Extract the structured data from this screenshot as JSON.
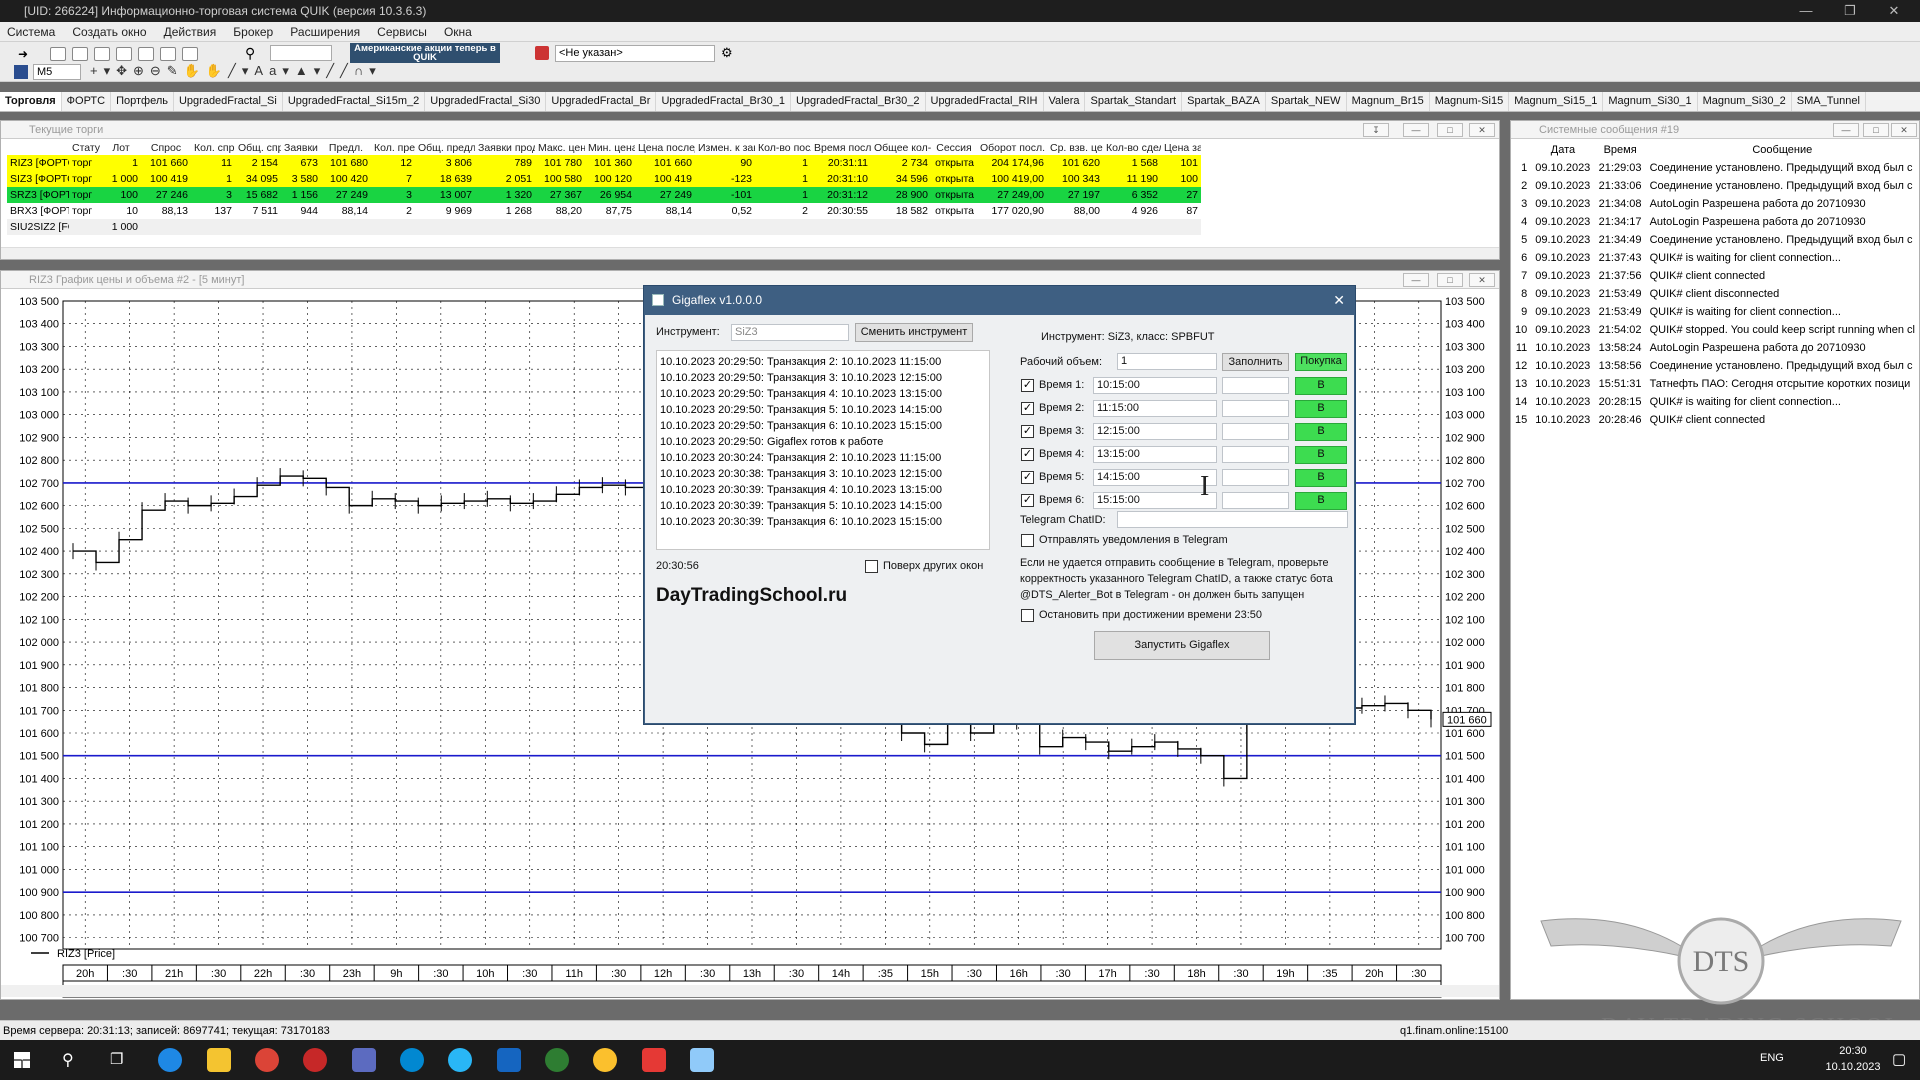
{
  "window": {
    "title": "[UID: 266224] Информационно-торговая система QUIK (версия 10.3.6.3)"
  },
  "menu": [
    "Система",
    "Создать окно",
    "Действия",
    "Брокер",
    "Расширения",
    "Сервисы",
    "Окна"
  ],
  "toolbar": {
    "banner": "Американские акции теперь в QUIK",
    "account_select": "<Не указан>",
    "interval": "M5"
  },
  "tabs": [
    "Торговля",
    "ФОРТС",
    "Портфель",
    "UpgradedFractal_Si",
    "UpgradedFractal_Si15m_2",
    "UpgradedFractal_Si30",
    "UpgradedFractal_Br",
    "UpgradedFractal_Br30_1",
    "UpgradedFractal_Br30_2",
    "UpgradedFractal_RIH",
    "Valera",
    "Spartak_Standart",
    "Spartak_BAZA",
    "Spartak_NEW",
    "Magnum_Br15",
    "Magnum-Si15",
    "Magnum_Si15_1",
    "Magnum_Si30_1",
    "Magnum_Si30_2",
    "SMA_Tunnel"
  ],
  "trades": {
    "title": "Текущие торги",
    "headers": [
      "",
      "Стату",
      "Лот",
      "Спрос",
      "Кол. спрос",
      "Общ. спрос",
      "Заявки к",
      "Предл.",
      "Кол. предл",
      "Общ. предл.",
      "Заявки прод.",
      "Макс. цена",
      "Мин. цена",
      "Цена послед.",
      "Измен. к закр.",
      "Кол-во послед.",
      "Время послед.",
      "Общее кол-во",
      "Сессия",
      "Оборот посл.",
      "Ср. взв. цена",
      "Кол-во сделок",
      "Цена за"
    ],
    "rows": [
      {
        "style": "y",
        "cells": [
          "RIZ3 [ФОРТС",
          "торг",
          "1",
          "101 660",
          "11",
          "2 154",
          "673",
          "101 680",
          "12",
          "3 806",
          "789",
          "101 780",
          "101 360",
          "101 660",
          "90",
          "1",
          "20:31:11",
          "2 734",
          "открыта",
          "204 174,96",
          "101 620",
          "1 568",
          "101"
        ]
      },
      {
        "style": "y",
        "cells": [
          "SIZ3 [ФОРТС",
          "торг",
          "1 000",
          "100 419",
          "1",
          "34 095",
          "3 580",
          "100 420",
          "7",
          "18 639",
          "2 051",
          "100 580",
          "100 120",
          "100 419",
          "-123",
          "1",
          "20:31:10",
          "34 596",
          "открыта",
          "100 419,00",
          "100 343",
          "11 190",
          "100"
        ]
      },
      {
        "style": "g",
        "cells": [
          "SRZ3 [ФОРТС",
          "торг",
          "100",
          "27 246",
          "3",
          "15 682",
          "1 156",
          "27 249",
          "3",
          "13 007",
          "1 320",
          "27 367",
          "26 954",
          "27 249",
          "-101",
          "1",
          "20:31:12",
          "28 900",
          "открыта",
          "27 249,00",
          "27 197",
          "6 352",
          "27"
        ]
      },
      {
        "style": "w",
        "cells": [
          "BRX3 [ФОРТС",
          "торг",
          "10",
          "88,13",
          "137",
          "7 511",
          "944",
          "88,14",
          "2",
          "9 969",
          "1 268",
          "88,20",
          "87,75",
          "88,14",
          "0,52",
          "2",
          "20:30:55",
          "18 582",
          "открыта",
          "177 020,90",
          "88,00",
          "4 926",
          "87"
        ]
      },
      {
        "style": "s",
        "cells": [
          "SIU2SIZ2 [FOI",
          "",
          "1 000",
          "",
          "",
          "",
          "",
          "",
          "",
          "",
          "",
          "",
          "",
          "",
          "",
          "",
          "",
          "",
          "",
          "",
          "",
          "",
          ""
        ]
      }
    ]
  },
  "system": {
    "title": "Системные сообщения #19",
    "headers": [
      "",
      "Дата",
      "Время",
      "Сообщение"
    ],
    "rows": [
      [
        "1",
        "09.10.2023",
        "21:29:03",
        "Соединение установлено. Предыдущий вход был с"
      ],
      [
        "2",
        "09.10.2023",
        "21:33:06",
        "Соединение установлено. Предыдущий вход был с"
      ],
      [
        "3",
        "09.10.2023",
        "21:34:08",
        "AutoLogin  Разрешена работа до 20710930"
      ],
      [
        "4",
        "09.10.2023",
        "21:34:17",
        "AutoLogin  Разрешена работа до 20710930"
      ],
      [
        "5",
        "09.10.2023",
        "21:34:49",
        "Соединение установлено. Предыдущий вход был с"
      ],
      [
        "6",
        "09.10.2023",
        "21:37:43",
        "QUIK# is waiting for client connection..."
      ],
      [
        "7",
        "09.10.2023",
        "21:37:56",
        "QUIK# client connected"
      ],
      [
        "8",
        "09.10.2023",
        "21:53:49",
        "QUIK# client disconnected"
      ],
      [
        "9",
        "09.10.2023",
        "21:53:49",
        "QUIK# is waiting for client connection..."
      ],
      [
        "10",
        "09.10.2023",
        "21:54:02",
        "QUIK# stopped. You could keep script running when cl"
      ],
      [
        "11",
        "10.10.2023",
        "13:58:24",
        "AutoLogin  Разрешена работа до 20710930"
      ],
      [
        "12",
        "10.10.2023",
        "13:58:56",
        "Соединение установлено. Предыдущий вход был с"
      ],
      [
        "13",
        "10.10.2023",
        "15:51:31",
        "Татнефть ПАО: Сегодня отсрытие коротких позици"
      ],
      [
        "14",
        "10.10.2023",
        "20:28:15",
        "QUIK# is waiting for client connection..."
      ],
      [
        "15",
        "10.10.2023",
        "20:28:46",
        "QUIK# client connected"
      ]
    ]
  },
  "chart": {
    "title": "RIZ3 График цены и объема #2 - [5 минут]",
    "legend": "RIZ3 [Price]",
    "price_badge": "101 660",
    "xticks": [
      "20h",
      ":30",
      "21h",
      ":30",
      "22h",
      ":30",
      "23h",
      "9h",
      ":30",
      "10h",
      ":30",
      "11h",
      ":30",
      "12h",
      ":30",
      "13h",
      ":30",
      "14h",
      ":35",
      "15h",
      ":30",
      "16h",
      ":30",
      "17h",
      ":30",
      "18h",
      ":30",
      "19h",
      ":35",
      "20h",
      ":30"
    ],
    "xsub": "10"
  },
  "chart_data": {
    "type": "line",
    "title": "RIZ3 График цены и объема #2 - [5 минут]",
    "ylim": [
      100650,
      103500
    ],
    "yticks": [
      "103 500",
      "103 400",
      "103 300",
      "103 200",
      "103 100",
      "103 000",
      "102 900",
      "102 800",
      "102 700",
      "102 600",
      "102 500",
      "102 400",
      "102 300",
      "102 200",
      "102 100",
      "102 000",
      "101 900",
      "101 800",
      "101 700",
      "101 600",
      "101 500",
      "101 400",
      "101 300",
      "101 200",
      "101 100",
      "101 000",
      "100 900",
      "100 800",
      "100 700"
    ],
    "hlines": [
      102700,
      101500,
      100900
    ],
    "series": [
      {
        "name": "RIZ3 [Price]",
        "values": [
          102400,
          102350,
          102450,
          102580,
          102620,
          102600,
          102610,
          102640,
          102690,
          102730,
          102720,
          102680,
          102600,
          102630,
          102620,
          102600,
          102610,
          102620,
          102630,
          102610,
          102620,
          102650,
          102680,
          102690,
          102680,
          102600,
          102200,
          102220,
          102150,
          102120,
          102100,
          102150,
          102200,
          101950,
          101800,
          101700,
          101600,
          101550,
          101650,
          101600,
          101680,
          101650,
          101540,
          101580,
          101560,
          101520,
          101540,
          101560,
          101530,
          101500,
          101400,
          101650,
          101700,
          101720,
          101700,
          101710,
          101720,
          101730,
          101700,
          101660
        ]
      }
    ]
  },
  "dialog": {
    "title": "Gigaflex v1.0.0.0",
    "instrument_label": "Инструмент:",
    "instrument_value": "SiZ3",
    "change_button": "Сменить инструмент",
    "instrument_info": "Инструмент: SiZ3, класс: SPBFUT",
    "log": [
      "10.10.2023 20:29:50: Транзакция 2: 10.10.2023 11:15:00",
      "10.10.2023 20:29:50: Транзакция 3: 10.10.2023 12:15:00",
      "10.10.2023 20:29:50: Транзакция 4: 10.10.2023 13:15:00",
      "10.10.2023 20:29:50: Транзакция 5: 10.10.2023 14:15:00",
      "10.10.2023 20:29:50: Транзакция 6: 10.10.2023 15:15:00",
      "10.10.2023 20:29:50: Gigaflex готов к работе",
      "10.10.2023 20:30:24: Транзакция 2: 10.10.2023 11:15:00",
      "10.10.2023 20:30:38: Транзакция 3: 10.10.2023 12:15:00",
      "10.10.2023 20:30:39: Транзакция 4: 10.10.2023 13:15:00",
      "10.10.2023 20:30:39: Транзакция 5: 10.10.2023 14:15:00",
      "10.10.2023 20:30:39: Транзакция 6: 10.10.2023 15:15:00"
    ],
    "clock": "20:30:56",
    "on_top_label": "Поверх других окон",
    "brand": "DayTradingSchool.ru",
    "volume_label": "Рабочий объем:",
    "volume_value": "1",
    "fill_button": "Заполнить",
    "buy_button": "Покупка",
    "times": [
      {
        "label": "Время 1:",
        "value": "10:15:00",
        "side": "B"
      },
      {
        "label": "Время 2:",
        "value": "11:15:00",
        "side": "B"
      },
      {
        "label": "Время 3:",
        "value": "12:15:00",
        "side": "B"
      },
      {
        "label": "Время 4:",
        "value": "13:15:00",
        "side": "B"
      },
      {
        "label": "Время 5:",
        "value": "14:15:00",
        "side": "B"
      },
      {
        "label": "Время 6:",
        "value": "15:15:00",
        "side": "B"
      }
    ],
    "telegram_label": "Telegram ChatID:",
    "telegram_notify": "Отправлять уведомления в Telegram",
    "telegram_note": "Если не удается отправить сообщение в Telegram, проверьте корректность указанного Telegram ChatID, а также статус бота @DTS_Alerter_Bot в Telegram - он должен быть запущен",
    "stop_label": "Остановить при достижении времени 23:50",
    "start_button": "Запустить Gigaflex"
  },
  "status": {
    "left": "Время сервера: 20:31:13; записей: 8697741; текущая: 73170183",
    "server": "q1.finam.online:15100"
  },
  "watermark": "DAY TRADING SCHOOL",
  "taskbar": {
    "lang": "ENG",
    "time": "20:30",
    "date": "10.10.2023"
  }
}
